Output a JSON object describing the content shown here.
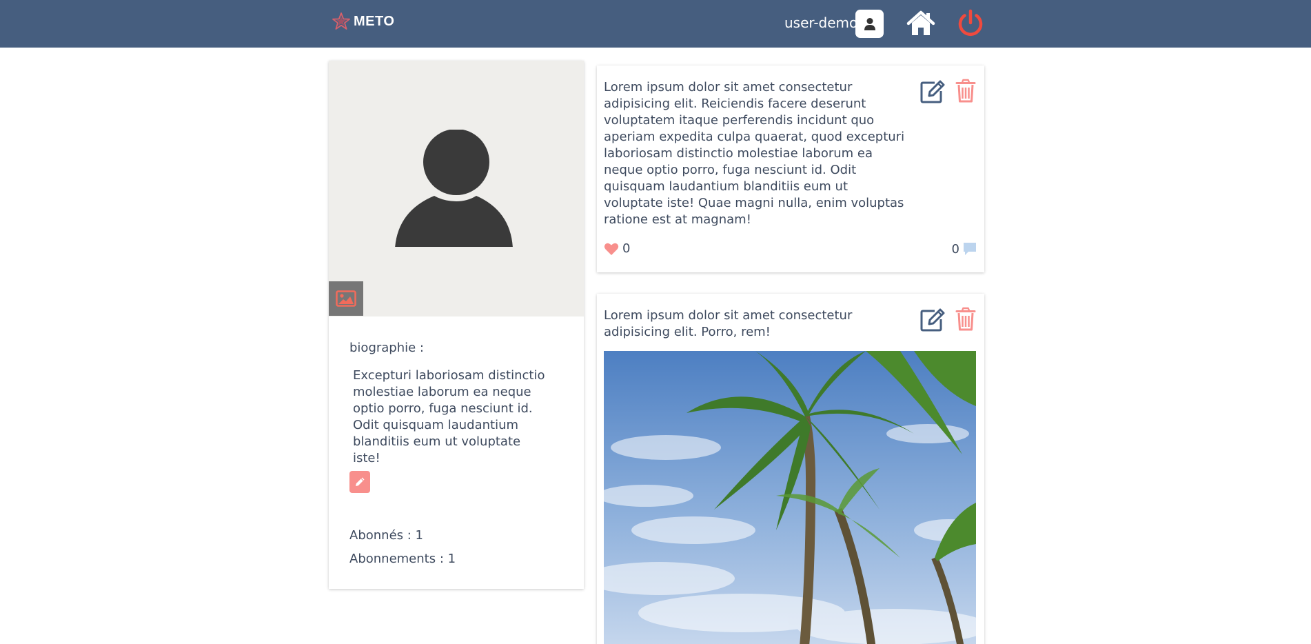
{
  "header": {
    "logo_text": "METO",
    "username": "user-demo"
  },
  "profile": {
    "bio_label": "biographie :",
    "bio_text": "Excepturi laboriosam distinctio molestiae laborum ea neque optio porro, fuga nesciunt id. Odit quisquam laudantium blanditiis eum ut voluptate iste!",
    "followers_label": "Abonnés : 1",
    "following_label": "Abonnements : 1"
  },
  "posts": [
    {
      "text": "Lorem ipsum dolor sit amet consectetur adipisicing elit. Reiciendis facere deserunt voluptatem itaque perferendis incidunt quo aperiam expedita culpa quaerat, quod excepturi laboriosam distinctio molestiae laborum ea neque optio porro, fuga nesciunt id. Odit quisquam laudantium blanditiis eum ut voluptate iste! Quae magni nulla, enim voluptas ratione est at magnam!",
      "likes": "0",
      "comments": "0"
    },
    {
      "text": "Lorem ipsum dolor sit amet consectetur adipisicing elit. Porro, rem!"
    }
  ],
  "colors": {
    "header_bg": "#465e7f",
    "accent_red": "#f26b5b",
    "soft_red": "#f88f8c",
    "icon_blue": "#465e7f",
    "comment_blue": "#bcd4ee"
  },
  "icons": {
    "logo": "star-logo-icon",
    "user": "user-icon",
    "home": "home-icon",
    "logout": "power-icon",
    "photo": "image-icon",
    "edit_bio": "pencil-icon",
    "edit_post": "edit-icon",
    "delete_post": "trash-icon",
    "like": "heart-icon",
    "comment": "comment-icon"
  }
}
